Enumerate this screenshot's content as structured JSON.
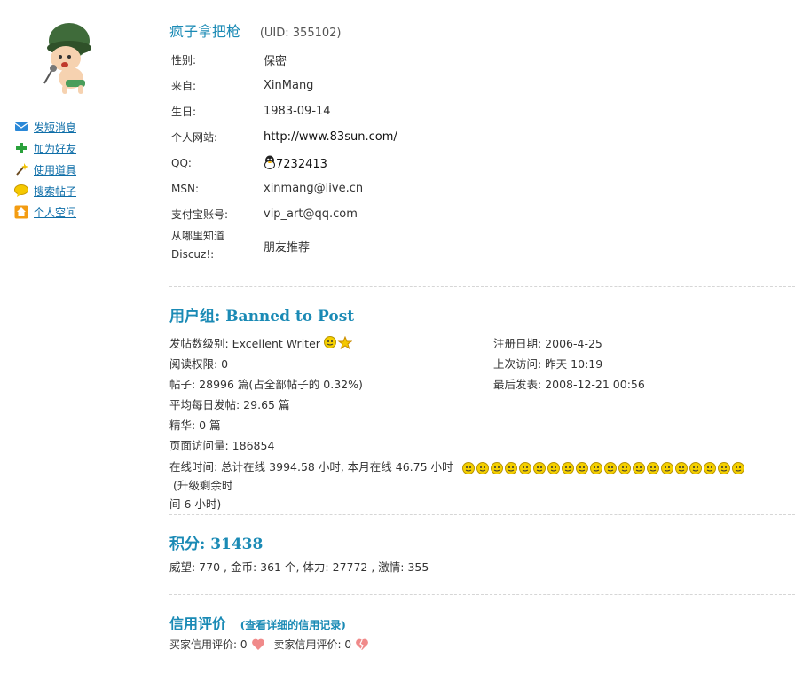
{
  "sidebar": {
    "menu": [
      {
        "label": "发短消息",
        "icon": "envelope-icon"
      },
      {
        "label": "加为好友",
        "icon": "plus-icon"
      },
      {
        "label": "使用道具",
        "icon": "wand-icon"
      },
      {
        "label": "搜索帖子",
        "icon": "speech-bubble-icon"
      },
      {
        "label": "个人空间",
        "icon": "home-icon"
      }
    ]
  },
  "profile": {
    "username": "疯子拿把枪",
    "uid": "(UID: 355102)",
    "fields": {
      "gender_label": "性别:",
      "gender": "保密",
      "from_label": "来自:",
      "from": "XinMang",
      "birthday_label": "生日:",
      "birthday": "1983-09-14",
      "site_label": "个人网站:",
      "site": "http://www.83sun.com/",
      "qq_label": "QQ:",
      "qq": "7232413",
      "msn_label": "MSN:",
      "msn": "xinmang@live.cn",
      "alipay_label": "支付宝账号:",
      "alipay": "vip_art@qq.com",
      "source_label_1": "从哪里知道",
      "source_label_2": "Discuz!:",
      "source": "朋友推荐"
    }
  },
  "group": {
    "title": "用户组: Banned to Post",
    "post_level": "发帖数级别: Excellent Writer",
    "read_access": "阅读权限: 0",
    "posts": "帖子: 28996 篇(占全部帖子的 0.32%)",
    "avg_daily": "平均每日发帖: 29.65 篇",
    "digest": "精华: 0 篇",
    "page_views": "页面访问量: 186854",
    "reg_date": "注册日期: 2006-4-25",
    "last_visit": "上次访问: 昨天 10:19",
    "last_post": "最后发表: 2008-12-21 00:56",
    "online_text": "在线时间: 总计在线  3994.58 小时, 本月在线  46.75 小时",
    "online_face_count": 20,
    "upgrade_text": "(升级剩余时",
    "upgrade_text2": "间  6 小时)"
  },
  "points": {
    "title": "积分: 31438",
    "detail": "威望: 770 , 金币: 361 个, 体力: 27772 , 激情: 355"
  },
  "credit": {
    "title": "信用评价",
    "link": "(查看详细的信用记录)",
    "buyer": "买家信用评价: 0",
    "seller": "卖家信用评价: 0"
  },
  "colors": {
    "accent": "#1a8ab5",
    "link": "#0e6ea8",
    "face": "#f5d000",
    "heart": "#f08a8a"
  }
}
